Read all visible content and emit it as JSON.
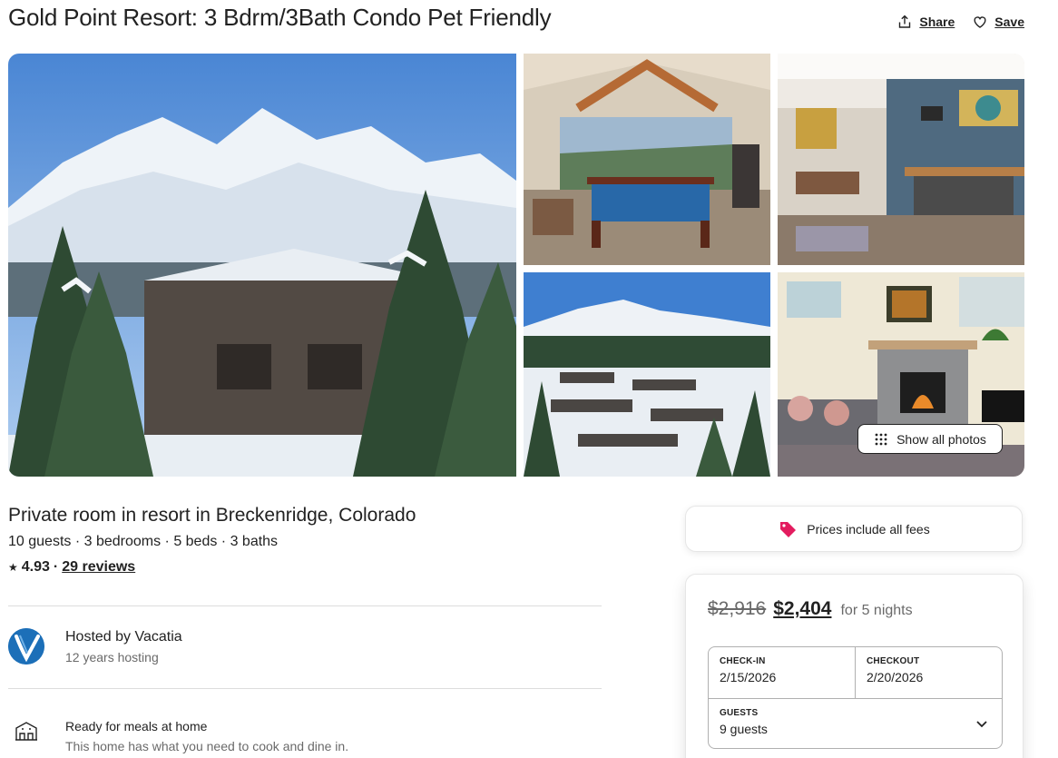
{
  "listing": {
    "title": "Gold Point Resort: 3 Bdrm/3Bath Condo Pet Friendly",
    "share_label": "Share",
    "save_label": "Save",
    "show_all_photos_label": "Show all photos",
    "subtitle": "Private room in resort in Breckenridge, Colorado",
    "specs": "10 guests · 3 bedrooms · 5 beds · 3 baths",
    "rating_star": "★",
    "rating": "4.93",
    "rating_separator": "·",
    "reviews": "29 reviews"
  },
  "host": {
    "name": "Hosted by Vacatia",
    "years": "12 years hosting"
  },
  "features": [
    {
      "icon": "kitchen-icon",
      "title": "Ready for meals at home",
      "description": "This home has what you need to cook and dine in."
    }
  ],
  "fees_notice": {
    "icon": "price-tag-icon",
    "text": "Prices include all fees"
  },
  "booking": {
    "original_price": "$2,916",
    "price": "$2,404",
    "price_suffix": "for 5 nights",
    "checkin_label": "CHECK-IN",
    "checkin_value": "2/15/2026",
    "checkout_label": "CHECKOUT",
    "checkout_value": "2/20/2026",
    "guests_label": "GUESTS",
    "guests_value": "9 guests"
  },
  "colors": {
    "brand_accent": "#e31c5f",
    "text_primary": "#222222",
    "text_secondary": "#6a6a6a",
    "border": "#b0b0b0",
    "host_avatar": "#1c6fb8"
  }
}
